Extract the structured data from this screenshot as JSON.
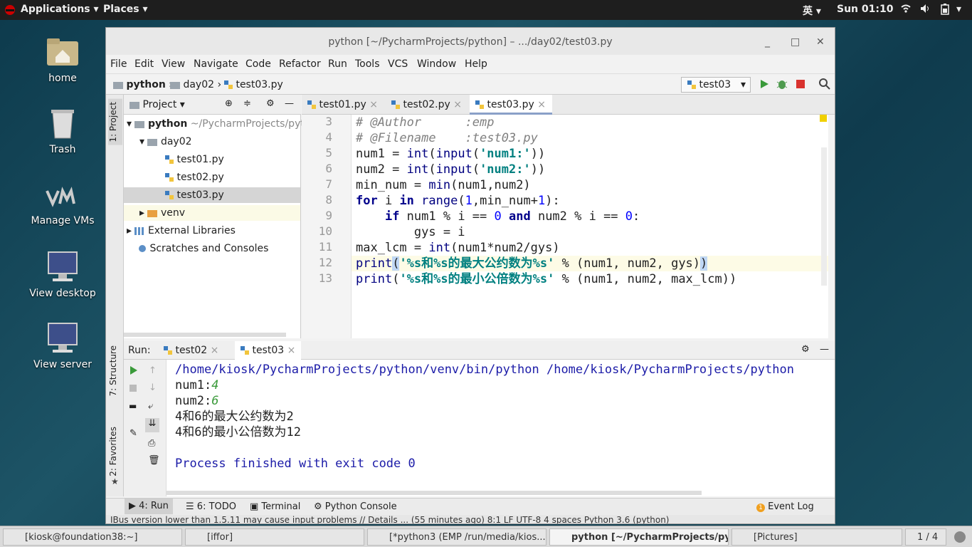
{
  "topbar": {
    "applications": "Applications",
    "places": "Places",
    "lang": "英",
    "time": "Sun 01:10"
  },
  "desktop": [
    {
      "label": "home"
    },
    {
      "label": "Trash"
    },
    {
      "label": "Manage VMs"
    },
    {
      "label": "View desktop"
    },
    {
      "label": "View server"
    }
  ],
  "window": {
    "title": "python [~/PycharmProjects/python] – .../day02/test03.py"
  },
  "menu": [
    "File",
    "Edit",
    "View",
    "Navigate",
    "Code",
    "Refactor",
    "Run",
    "Tools",
    "VCS",
    "Window",
    "Help"
  ],
  "breadcrumb": [
    "python",
    "day02",
    "test03.py"
  ],
  "run_config": "test03",
  "side_tabs": {
    "project": "1: Project",
    "structure": "7: Structure",
    "favorites": "2: Favorites"
  },
  "project": {
    "header": "Project",
    "root": "python",
    "root_path": "~/PycharmProjects/python",
    "items": [
      "day02",
      "test01.py",
      "test02.py",
      "test03.py",
      "venv",
      "External Libraries",
      "Scratches and Consoles"
    ]
  },
  "editor_tabs": [
    "test01.py",
    "test02.py",
    "test03.py"
  ],
  "code": {
    "line_numbers": [
      "3",
      "4",
      "5",
      "6",
      "7",
      "8",
      "9",
      "10",
      "11",
      "12",
      "13"
    ],
    "l3": "# @Author      :emp",
    "l4": "# @Filename    :test03.py",
    "l5_a": "num1 = ",
    "l5_b": "int",
    "l5_c": "(",
    "l5_d": "input",
    "l5_e": "(",
    "l5_f": "'num1:'",
    "l5_g": "))",
    "l6_a": "num2 = ",
    "l6_b": "int",
    "l6_c": "(",
    "l6_d": "input",
    "l6_e": "(",
    "l6_f": "'num2:'",
    "l6_g": "))",
    "l7_a": "min_num = ",
    "l7_b": "min",
    "l7_c": "(num1,num2)",
    "l8_a": "for",
    "l8_b": " i ",
    "l8_c": "in",
    "l8_d": " ",
    "l8_e": "range",
    "l8_f": "(",
    "l8_g": "1",
    "l8_h": ",min_num+",
    "l8_i": "1",
    "l8_j": "):",
    "l9_a": "    ",
    "l9_b": "if",
    "l9_c": " num1 % i == ",
    "l9_d": "0",
    "l9_e": " ",
    "l9_f": "and",
    "l9_g": " num2 % i == ",
    "l9_h": "0",
    "l9_i": ":",
    "l10": "        gys = i",
    "l11_a": "max_lcm = ",
    "l11_b": "int",
    "l11_c": "(num1*num2/gys)",
    "l12_a": "print",
    "l12_b": "(",
    "l12_c": "'%s和%s的最大公约数为%s'",
    "l12_d": " % (num1, num2, gys)",
    "l12_e": ")",
    "l13_a": "print",
    "l13_b": "(",
    "l13_c": "'%s和%s的最小公倍数为%s'",
    "l13_d": " % (num1, num2, max_lcm))"
  },
  "run": {
    "label": "Run:",
    "tabs": [
      "test02",
      "test03"
    ],
    "cmd": "/home/kiosk/PycharmProjects/python/venv/bin/python /home/kiosk/PycharmProjects/python",
    "p1": "num1:",
    "v1": "4",
    "p2": "num2:",
    "v2": "6",
    "out1": "4和6的最大公约数为2",
    "out2": "4和6的最小公倍数为12",
    "finish": "Process finished with exit code 0"
  },
  "bottom_tabs": [
    "4: Run",
    "6: TODO",
    "Terminal",
    "Python Console"
  ],
  "event_log": {
    "count": "1",
    "label": "Event Log"
  },
  "status": "IBus version lower than 1.5.11 may cause input problems  // Details ...  (55 minutes ago)     8:1   LF   UTF-8   4 spaces   Python 3.6 (python)",
  "taskbar": [
    "[kiosk@foundation38:~]",
    "[iffor]",
    "[*python3 (EMP /run/media/kios...",
    "python [~/PycharmProjects/pyt...",
    "[Pictures]",
    "1 / 4"
  ],
  "colors": {
    "run_green": "#3a9a3a",
    "stop_red": "#d9322e",
    "link_blue": "#1c1ca8"
  }
}
